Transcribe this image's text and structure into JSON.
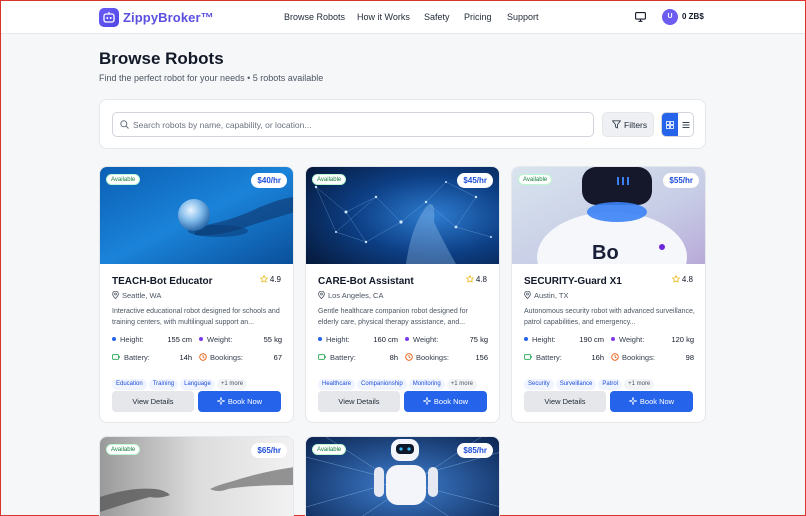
{
  "header": {
    "brand": "ZippyBroker™",
    "nav": [
      "Browse Robots",
      "How it Works",
      "Safety",
      "Pricing",
      "Support"
    ],
    "avatar_initial": "U",
    "balance": "0 ZB$"
  },
  "page": {
    "title": "Browse Robots",
    "subtitle": "Find the perfect robot for your needs • 5 robots available"
  },
  "search": {
    "placeholder": "Search robots by name, capability, or location...",
    "value": "",
    "filters_label": "Filters"
  },
  "labels": {
    "height": "Height:",
    "weight": "Weight:",
    "battery": "Battery:",
    "bookings": "Bookings:",
    "view_details": "View Details",
    "book_now": "Book Now",
    "available": "Available"
  },
  "colors": {
    "accent": "#2563eb",
    "brand": "#5b4fe0",
    "available_green": "#15803d"
  },
  "robots": [
    {
      "name": "TEACH-Bot Educator",
      "price": "$40/hr",
      "rating": "4.9",
      "location": "Seattle, WA",
      "description": "Interactive educational robot designed for schools and training centers, with multilingual support an...",
      "height": "155 cm",
      "weight": "55 kg",
      "battery": "14h",
      "bookings": "67",
      "tags": [
        "Education",
        "Training",
        "Language",
        "+1 more"
      ]
    },
    {
      "name": "CARE-Bot Assistant",
      "price": "$45/hr",
      "rating": "4.8",
      "location": "Los Angeles, CA",
      "description": "Gentle healthcare companion robot designed for elderly care, physical therapy assistance, and...",
      "height": "160 cm",
      "weight": "75 kg",
      "battery": "8h",
      "bookings": "156",
      "tags": [
        "Healthcare",
        "Companionship",
        "Monitoring",
        "+1 more"
      ]
    },
    {
      "name": "SECURITY-Guard X1",
      "price": "$55/hr",
      "rating": "4.8",
      "location": "Austin, TX",
      "description": "Autonomous security robot with advanced surveillance, patrol capabilities, and emergency...",
      "height": "190 cm",
      "weight": "120 kg",
      "battery": "16h",
      "bookings": "98",
      "tags": [
        "Security",
        "Surveillance",
        "Patrol",
        "+1 more"
      ]
    },
    {
      "price": "$65/hr"
    },
    {
      "price": "$85/hr"
    }
  ]
}
